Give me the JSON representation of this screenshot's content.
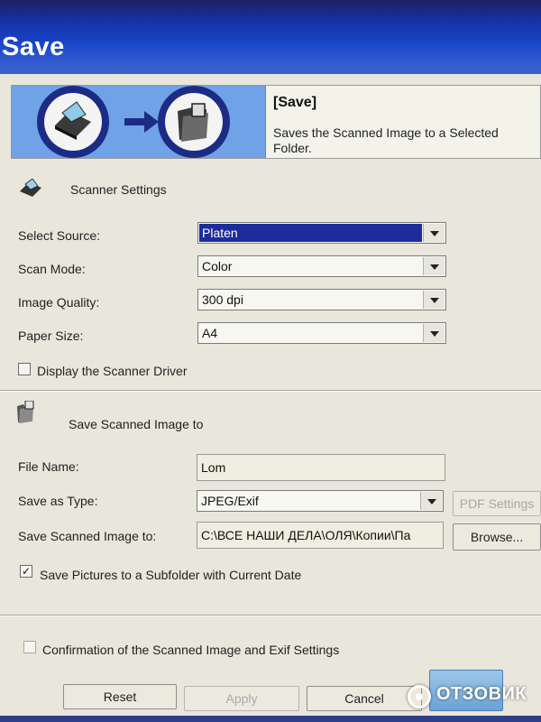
{
  "window": {
    "title": "Save"
  },
  "banner": {
    "title": "[Save]",
    "description": "Saves the Scanned Image to a Selected Folder."
  },
  "scanner_settings": {
    "title": "Scanner Settings",
    "select_source": {
      "label": "Select Source:",
      "value": "Platen"
    },
    "scan_mode": {
      "label": "Scan Mode:",
      "value": "Color"
    },
    "image_quality": {
      "label": "Image Quality:",
      "value": "300 dpi"
    },
    "paper_size": {
      "label": "Paper Size:",
      "value": "A4"
    },
    "display_driver": {
      "label": "Display the Scanner Driver",
      "checked": false
    }
  },
  "save_settings": {
    "title": "Save Scanned Image to",
    "file_name": {
      "label": "File Name:",
      "value": "Lom"
    },
    "save_as_type": {
      "label": "Save as Type:",
      "value": "JPEG/Exif"
    },
    "pdf_settings_label": "PDF Settings",
    "save_to": {
      "label": "Save Scanned Image to:",
      "value": "C:\\ВСЕ НАШИ ДЕЛА\\ОЛЯ\\Копии\\Па"
    },
    "browse_label": "Browse...",
    "subfolder": {
      "label": "Save Pictures to a Subfolder with Current Date",
      "checked": true,
      "mark": "✓"
    }
  },
  "confirmation": {
    "label": "Confirmation of the Scanned Image and Exif Settings",
    "checked": false
  },
  "footer": {
    "reset_label": "Reset",
    "apply_label": "Apply",
    "cancel_label": "Cancel"
  },
  "watermark": "ОТЗОВИК",
  "icons": {
    "scanner": "scanner-icon",
    "arrow": "arrow-right-icon",
    "folder": "folder-icon"
  },
  "colors": {
    "title_bar": "#1742c4",
    "selection": "#1e2b9a",
    "banner_art": "#6fa2e6"
  }
}
